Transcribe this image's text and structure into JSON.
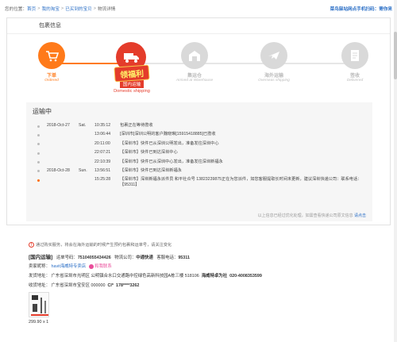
{
  "breadcrumb": {
    "prefix": "您的位置：",
    "items": [
      "首页",
      "我的淘宝",
      "已买到的宝贝",
      "物流详情"
    ],
    "sep": ">"
  },
  "top_right": "菜鸟驿站网点手机扫码：寄你来",
  "panel_title": "包裹信息",
  "steps": [
    {
      "cn": "下单",
      "en": "Ordered",
      "color": "#ff7a1a",
      "icon": "cart-icon"
    },
    {
      "cn": "国内运输",
      "en": "Domestic shipping",
      "color": "#e43c2b",
      "icon": "truck-icon"
    },
    {
      "cn": "集运仓",
      "en": "Arrived at Warehouse",
      "color": "#d9d9d9",
      "icon": "warehouse-icon"
    },
    {
      "cn": "海外运输",
      "en": "Overseas shipping",
      "color": "#d9d9d9",
      "icon": "plane-icon"
    },
    {
      "cn": "签收",
      "en": "Delivered",
      "color": "#d9d9d9",
      "icon": "document-icon"
    }
  ],
  "badge": {
    "title": "领福利",
    "sub": "国内运输"
  },
  "logistics": {
    "title": "运输中",
    "rows": [
      {
        "date": "2018-Oct-27",
        "dow": "Sat.",
        "time": "10:35:12",
        "msg": "包裹正在等待揽收"
      },
      {
        "date": "",
        "dow": "",
        "time": "13:06:44",
        "msg": "[深圳市]深圳公明的客户魏晓琳[15915418885]已揽收"
      },
      {
        "date": "",
        "dow": "",
        "time": "20:11:00",
        "msg": "【深圳市】快件已从深圳公明发出，准备发往深圳中心"
      },
      {
        "date": "",
        "dow": "",
        "time": "22:07:21",
        "msg": "【深圳市】快件已到达深圳中心"
      },
      {
        "date": "",
        "dow": "",
        "time": "22:10:39",
        "msg": "【深圳市】快件已从深圳中心发出，准备发往深圳新福永"
      },
      {
        "date": "2018-Oct-28",
        "dow": "Sun.",
        "time": "13:56:51",
        "msg": "【深圳市】快件已到达深圳新福永"
      },
      {
        "date": "",
        "dow": "",
        "time": "15:25:28",
        "msg": "【深圳市】深圳新福永派件员 和平社众号 13823239875正在为您派件，如您客服提取长时间未更新，建议深圳快递公司：联系电话：【95311】"
      }
    ],
    "footer": "以上信息已经过优化处理，如需查看快递公司原文信息",
    "footer_link": "请点击"
  },
  "notice": "通过购买服务，将会在海外运输的时候产生预约包裹和运单号，请关注变化",
  "shipment": {
    "type_label": "[国内运输]",
    "waybill_label": "运单号码：",
    "waybill": "75104055434426",
    "carrier_label": "物流公司：",
    "carrier": "中通快递",
    "phone_label": "客服电话：",
    "phone": "95311"
  },
  "seller_line": {
    "label": "卖家昵称：",
    "name": "havit海威特专卖店",
    "tag": "和我联系"
  },
  "from_line": {
    "label": "发货地址：",
    "value": "广东省深圳市光明区 公明镇合水口交通路中控绿色高新科技园A栋三楼 518106",
    "name": "海威特卓为社",
    "phone": "020-4008353599"
  },
  "to_line": {
    "label": "收货地址：",
    "value": "广东省深圳市宝安区 000000",
    "name": "Cl*",
    "phone": "178****3262"
  },
  "item": {
    "price": "299.90 x 1"
  },
  "colors": {
    "accent": "#e43c2b",
    "link": "#2b6fc6",
    "orange": "#ff7a1a"
  }
}
